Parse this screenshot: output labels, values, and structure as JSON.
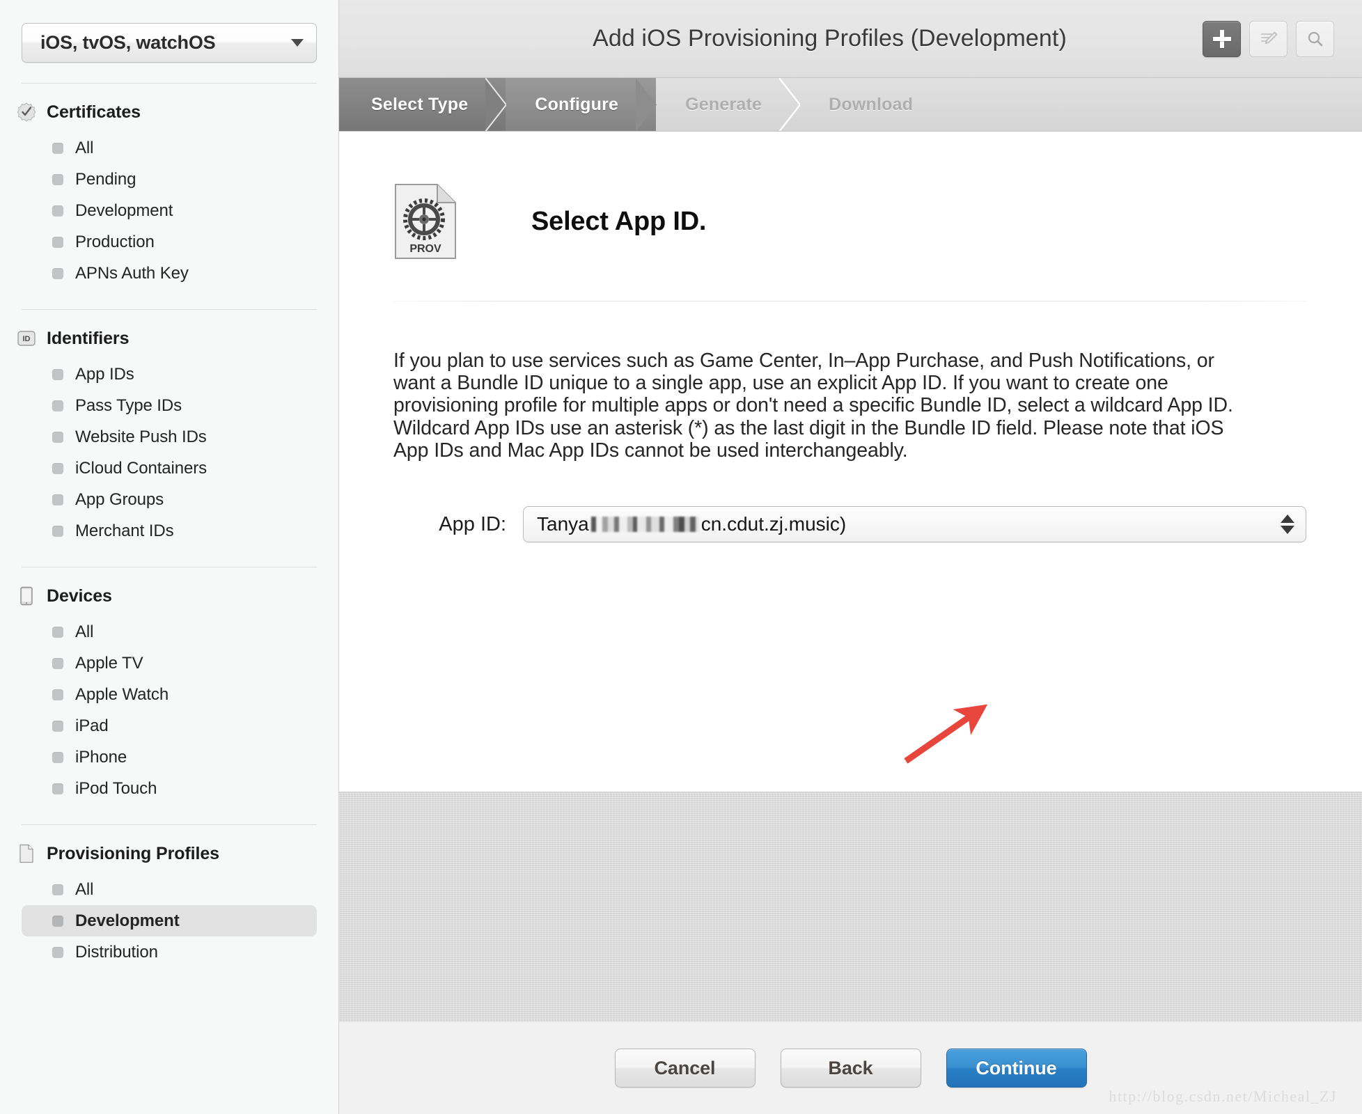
{
  "sidebar": {
    "platform_selector": {
      "value": "iOS, tvOS, watchOS",
      "icon": "chevron-down-icon"
    },
    "groups": [
      {
        "title": "Certificates",
        "icon": "certificate-seal-icon",
        "items": [
          {
            "label": "All",
            "selected": false
          },
          {
            "label": "Pending",
            "selected": false
          },
          {
            "label": "Development",
            "selected": false
          },
          {
            "label": "Production",
            "selected": false
          },
          {
            "label": "APNs Auth Key",
            "selected": false
          }
        ]
      },
      {
        "title": "Identifiers",
        "icon": "id-badge-icon",
        "items": [
          {
            "label": "App IDs",
            "selected": false
          },
          {
            "label": "Pass Type IDs",
            "selected": false
          },
          {
            "label": "Website Push IDs",
            "selected": false
          },
          {
            "label": "iCloud Containers",
            "selected": false
          },
          {
            "label": "App Groups",
            "selected": false
          },
          {
            "label": "Merchant IDs",
            "selected": false
          }
        ]
      },
      {
        "title": "Devices",
        "icon": "mobile-device-icon",
        "items": [
          {
            "label": "All",
            "selected": false
          },
          {
            "label": "Apple TV",
            "selected": false
          },
          {
            "label": "Apple Watch",
            "selected": false
          },
          {
            "label": "iPad",
            "selected": false
          },
          {
            "label": "iPhone",
            "selected": false
          },
          {
            "label": "iPod Touch",
            "selected": false
          }
        ]
      },
      {
        "title": "Provisioning Profiles",
        "icon": "document-icon",
        "items": [
          {
            "label": "All",
            "selected": false
          },
          {
            "label": "Development",
            "selected": true
          },
          {
            "label": "Distribution",
            "selected": false
          }
        ]
      }
    ]
  },
  "header": {
    "title": "Add iOS Provisioning Profiles (Development)",
    "actions": [
      {
        "name": "add-button",
        "icon": "plus-icon",
        "state": "active"
      },
      {
        "name": "edit-button",
        "icon": "edit-pencil-icon",
        "state": "default"
      },
      {
        "name": "search-button",
        "icon": "search-icon",
        "state": "default"
      }
    ]
  },
  "steps": [
    {
      "label": "Select Type",
      "state": "done"
    },
    {
      "label": "Configure",
      "state": "active"
    },
    {
      "label": "Generate",
      "state": "idle"
    },
    {
      "label": "Download",
      "state": "idle"
    }
  ],
  "content": {
    "icon_label": "PROV",
    "heading": "Select App ID.",
    "paragraph": "If you plan to use services such as Game Center, In–App Purchase, and Push Notifications, or want a Bundle ID unique to a single app, use an explicit App ID. If you want to create one provisioning profile for multiple apps or don't need a specific Bundle ID, select a wildcard App ID. Wildcard App IDs use an asterisk (*) as the last digit in the Bundle ID field. Please note that iOS App IDs and Mac App IDs cannot be used interchangeably.",
    "app_id_field": {
      "label": "App ID:",
      "value_prefix": "Tanya",
      "value_suffix": "cn.cdut.zj.music)",
      "redacted": true,
      "stepper_icon": "up-down-stepper-icon"
    }
  },
  "annotation": {
    "arrow_color": "#E8453C",
    "points_to": "app-id-select"
  },
  "footer": {
    "buttons": [
      {
        "label": "Cancel",
        "style": "gray"
      },
      {
        "label": "Back",
        "style": "gray"
      },
      {
        "label": "Continue",
        "style": "blue"
      }
    ]
  },
  "watermark": "http://blog.csdn.net/Micheal_ZJ"
}
